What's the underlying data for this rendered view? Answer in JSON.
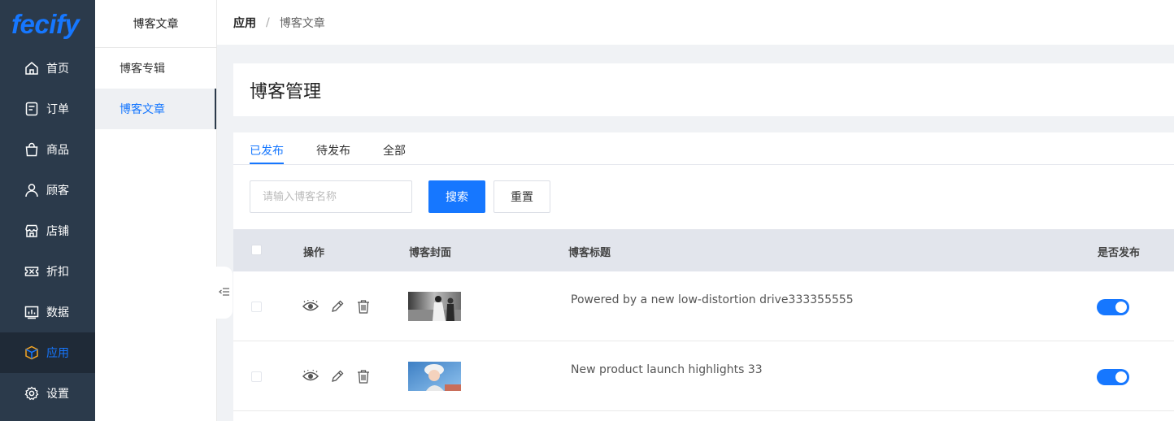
{
  "app": {
    "logo": "fecify"
  },
  "sidebar": {
    "items": [
      {
        "label": "首页",
        "icon": "home-icon"
      },
      {
        "label": "订单",
        "icon": "order-icon"
      },
      {
        "label": "商品",
        "icon": "bag-icon"
      },
      {
        "label": "顾客",
        "icon": "user-icon"
      },
      {
        "label": "店铺",
        "icon": "store-icon"
      },
      {
        "label": "折扣",
        "icon": "ticket-icon"
      },
      {
        "label": "数据",
        "icon": "chart-icon"
      },
      {
        "label": "应用",
        "icon": "cube-icon",
        "active": true
      },
      {
        "label": "设置",
        "icon": "gear-icon"
      }
    ]
  },
  "subnav": {
    "title": "博客文章",
    "items": [
      {
        "label": "博客专辑"
      },
      {
        "label": "博客文章",
        "active": true
      }
    ]
  },
  "breadcrumb": {
    "root": "应用",
    "separator": "/",
    "current": "博客文章"
  },
  "page": {
    "title": "博客管理"
  },
  "tabs": [
    {
      "label": "已发布",
      "active": true
    },
    {
      "label": "待发布"
    },
    {
      "label": "全部"
    }
  ],
  "search": {
    "placeholder": "请输入博客名称",
    "value": "",
    "search_label": "搜索",
    "reset_label": "重置"
  },
  "table": {
    "headers": {
      "action": "操作",
      "cover": "博客封面",
      "title": "博客标题",
      "published": "是否发布"
    },
    "rows": [
      {
        "title": "Powered by a new low-distortion drive333355555",
        "published": true
      },
      {
        "title": "New product launch highlights 33",
        "published": true
      }
    ]
  },
  "colors": {
    "accent": "#1677ff",
    "sidebar_bg": "#2b3a4b",
    "sidebar_active_bg": "#1f2a37"
  }
}
